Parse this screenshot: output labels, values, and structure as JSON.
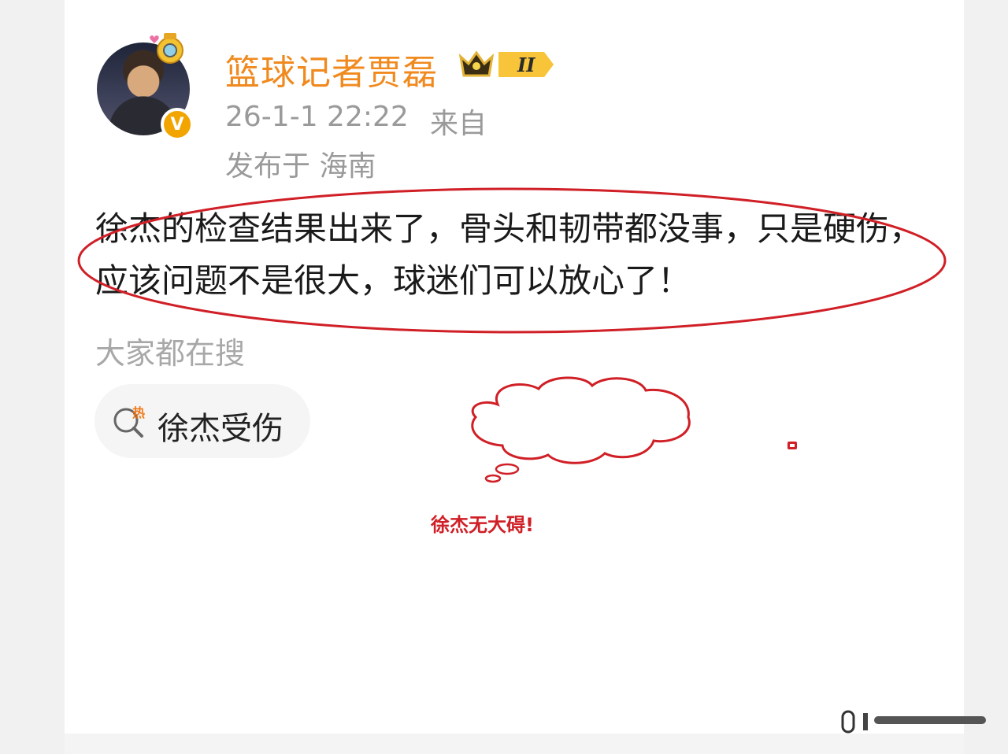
{
  "post": {
    "username": "篮球记者贾磊",
    "vip_level": "II",
    "time": "26-1-1 22:22",
    "source_prefix": "来自",
    "location": "发布于 海南",
    "text": "徐杰的检查结果出来了，骨头和韧带都没事，只是硬伤，应该问题不是很大，球迷们可以放心了！"
  },
  "trending": {
    "label": "大家都在搜",
    "hot_badge": "热",
    "items": [
      {
        "text": "徐杰受伤",
        "icon": "hot-search-icon"
      }
    ]
  },
  "annotation": {
    "text": "徐杰无大碍!"
  },
  "colors": {
    "username": "#f08a1f",
    "meta": "#9a9a9a",
    "annotation_red": "#d01f26",
    "verified_badge": "#f2a400"
  },
  "icons": {
    "avatar_pendant": "camera-pendant-icon",
    "verified": "verified-v-icon",
    "crown": "crown-icon"
  }
}
